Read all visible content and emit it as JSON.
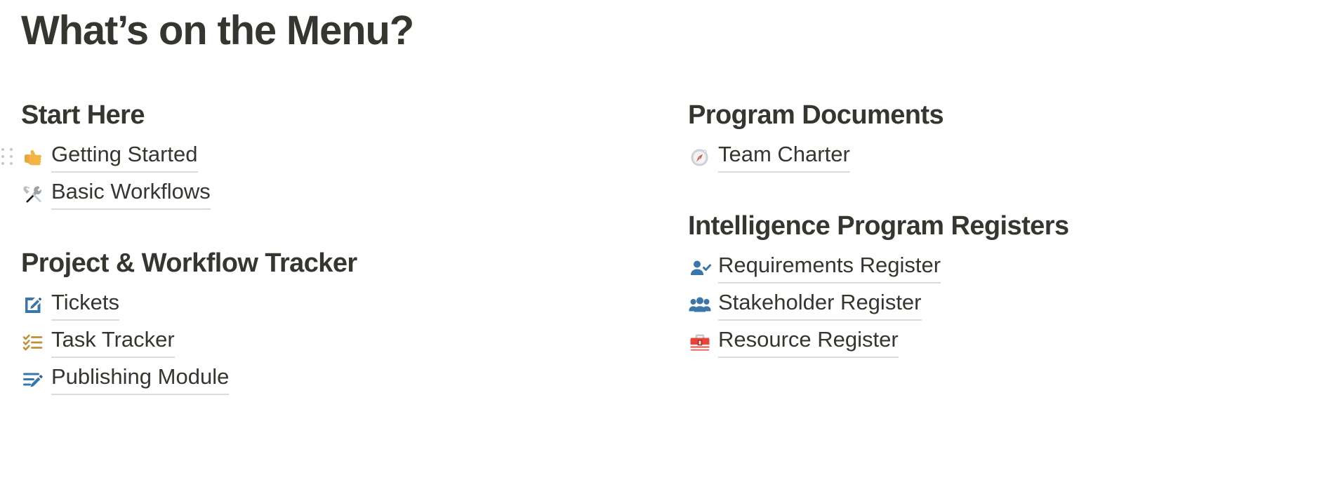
{
  "page": {
    "title": "What’s on the Menu?",
    "text_color": "#37352f",
    "underline_color": "#dcdbd7",
    "background": "#ffffff"
  },
  "drag_handle": {
    "name": "drag-handle",
    "dot_color": "#c7c6c2",
    "dot_count": 6,
    "attached_to": "Getting Started"
  },
  "columns": {
    "left": {
      "sections": [
        {
          "heading": "Start Here",
          "items": [
            {
              "label": "Getting Started",
              "icon": "pointing-right-hand-icon",
              "emoji": "👉",
              "has_drag_handle": true
            },
            {
              "label": "Basic Workflows",
              "icon": "hammer-and-wrench-icon",
              "emoji": "🛠️",
              "has_drag_handle": false
            }
          ]
        },
        {
          "heading": "Project & Workflow Tracker",
          "items": [
            {
              "label": "Tickets",
              "icon": "memo-pencil-square-icon",
              "emoji": "",
              "has_drag_handle": false
            },
            {
              "label": "Task Tracker",
              "icon": "checklist-icon",
              "emoji": "",
              "has_drag_handle": false
            },
            {
              "label": "Publishing Module",
              "icon": "edit-lines-pencil-icon",
              "emoji": "",
              "has_drag_handle": false
            }
          ]
        }
      ]
    },
    "right": {
      "sections": [
        {
          "heading": "Program Documents",
          "items": [
            {
              "label": "Team Charter",
              "icon": "compass-icon",
              "emoji": "🧭",
              "has_drag_handle": false
            }
          ]
        },
        {
          "heading": "Intelligence Program Registers",
          "items": [
            {
              "label": "Requirements Register",
              "icon": "person-check-icon",
              "emoji": "",
              "has_drag_handle": false
            },
            {
              "label": "Stakeholder Register",
              "icon": "people-group-icon",
              "emoji": "",
              "has_drag_handle": false
            },
            {
              "label": "Resource Register",
              "icon": "toolbox-icon",
              "emoji": "🧰",
              "has_drag_handle": false
            }
          ]
        }
      ]
    }
  },
  "icon_colors": {
    "blue": "#3a76a8",
    "gold": "#bf9039",
    "red": "#e8443a",
    "gray": "#8a8a8a"
  }
}
